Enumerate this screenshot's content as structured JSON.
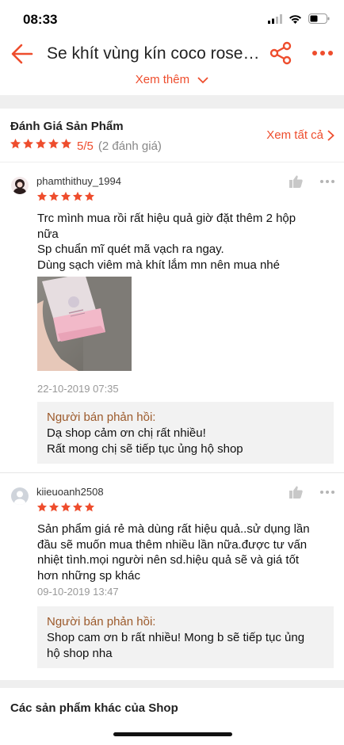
{
  "status": {
    "time": "08:33"
  },
  "nav": {
    "title": "Se khít vùng kín coco rose…",
    "see_more": "Xem thêm"
  },
  "rating": {
    "title": "Đánh Giá Sản Phẩm",
    "score": "5/5",
    "count": "(2 đánh giá)",
    "see_all": "Xem tất cả",
    "stars": 5
  },
  "reviews": [
    {
      "username": "phamthithuy_1994",
      "stars": 5,
      "text_lines": [
        "Trc mình mua rồi rất hiệu quả giờ đặt thêm 2 hộp",
        "nữa",
        "Sp chuẩn mĩ quét mã vạch ra ngay.",
        "Dùng sạch viêm mà khít lắm mn nên mua nhé"
      ],
      "date": "22-10-2019 07:35",
      "reply_title": "Người bán phản hồi:",
      "reply_lines": [
        "Dạ shop cảm ơn chị rất nhiều!",
        "Rất mong chị sẽ tiếp tục ủng hộ shop"
      ]
    },
    {
      "username": "kiieuoanh2508",
      "stars": 5,
      "text_lines": [
        "Sản phẩm giá rẻ mà dùng rất hiệu quả..sử dụng lần",
        "đầu sẽ muốn mua thêm nhiều  lần nữa.được tư vấn",
        "nhiệt tình.mọi người nên sd.hiệu quả sẽ và giá tốt",
        "hơn những sp khác"
      ],
      "date": "09-10-2019 13:47",
      "reply_title": "Người bán phản hồi:",
      "reply_lines": [
        "Shop cam ơn b rất nhiều! Mong b sẽ tiếp tục ủng",
        "hộ shop nha"
      ]
    }
  ],
  "other_products": {
    "title": "Các sản phẩm khác của Shop"
  },
  "colors": {
    "accent": "#ee4d2d",
    "star": "#ee4d2d",
    "reply_title": "#9c5a2b"
  }
}
